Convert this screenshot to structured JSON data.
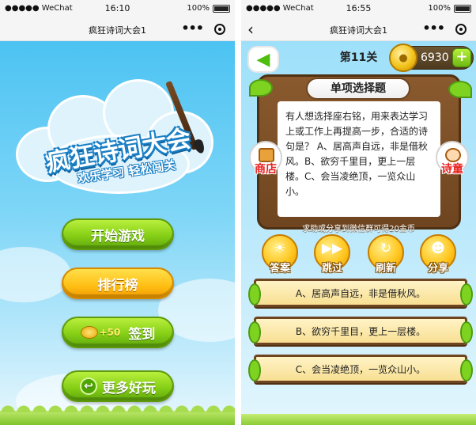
{
  "left_screen": {
    "status": {
      "carrier": "●●●●● WeChat",
      "time": "16:10",
      "battery": "100%"
    },
    "title": "疯狂诗词大会1",
    "logo": {
      "main": "疯狂诗词大会",
      "subtitle": "欢乐学习 轻松闯关"
    },
    "menu": {
      "start": "开始游戏",
      "ranking": "排行榜",
      "checkin_bonus": "+50",
      "checkin": "签到",
      "more": "更多好玩"
    }
  },
  "right_screen": {
    "status": {
      "carrier": "●●●●● WeChat",
      "time": "16:55",
      "battery": "100%"
    },
    "title": "疯狂诗词大会1",
    "level": "第11关",
    "coins": "6930",
    "board_title": "单项选择题",
    "question": "有人想选择座右铭，用来表达学习上或工作上再提高一步，合适的诗句是？ A、居高声自远，非是借秋风。B、欲穷千里目，更上一层楼。C、会当凌绝顶，一览众山小。",
    "side_left": "商店",
    "side_right": "诗童",
    "hint": "求助或分享到微信群可得20金币",
    "tools": [
      {
        "label": "答案",
        "icon": "lightbulb-icon"
      },
      {
        "label": "跳过",
        "icon": "fast-forward-icon"
      },
      {
        "label": "刷新",
        "icon": "refresh-icon"
      },
      {
        "label": "分享",
        "icon": "share-people-icon"
      }
    ],
    "answers": [
      "A、居高声自远，非是借秋风。",
      "B、欲穷千里目，更上一层楼。",
      "C、会当凌绝顶，一览众山小。"
    ]
  },
  "colors": {
    "green_button": "#86cf16",
    "yellow_button": "#ffbe14",
    "board_brown": "#6e4520",
    "sky_blue": "#4cc3f2"
  }
}
